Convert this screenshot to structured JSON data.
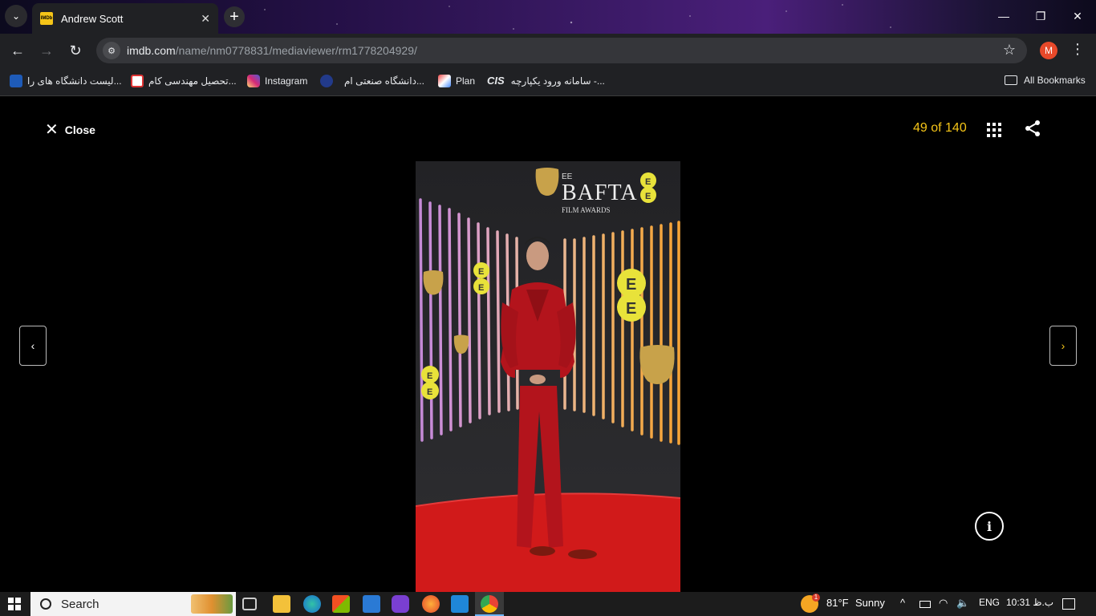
{
  "browser": {
    "tab_title": "Andrew Scott",
    "favicon_text": "IMDb",
    "url_host": "imdb.com",
    "url_path": "/name/nm0778831/mediaviewer/rm1778204929/",
    "profile_initial": "M"
  },
  "bookmarks": [
    {
      "label": "لیست دانشگاه های را...",
      "icon": "bookmark-icon-1",
      "color": "#1e5bb8"
    },
    {
      "label": "تحصیل مهندسی کام...",
      "icon": "bookmark-icon-2",
      "color": "#d33"
    },
    {
      "label": "Instagram",
      "icon": "instagram-icon",
      "color": "#d62976"
    },
    {
      "label": "دانشگاه صنعتی ام...",
      "icon": "university-icon",
      "color": "#223a8a"
    },
    {
      "label": "Plan",
      "icon": "plan-icon",
      "color": "#ccc"
    },
    {
      "label": "سامانه ورود یکپارچه -...",
      "icon": "cas-icon",
      "color": "#fff"
    }
  ],
  "all_bookmarks_label": "All Bookmarks",
  "viewer": {
    "close_label": "Close",
    "counter": "49 of 140",
    "info_label": "i"
  },
  "photo": {
    "brand_small": "EE",
    "brand": "BAFTA",
    "brand_sub": "FILM AWARDS",
    "ee_mark": "EE"
  },
  "taskbar": {
    "search_label": "Search",
    "weather_temp": "81°F",
    "weather_text": "Sunny",
    "weather_badge": "1",
    "language": "ENG",
    "time": "10:31 ب.ظ"
  }
}
